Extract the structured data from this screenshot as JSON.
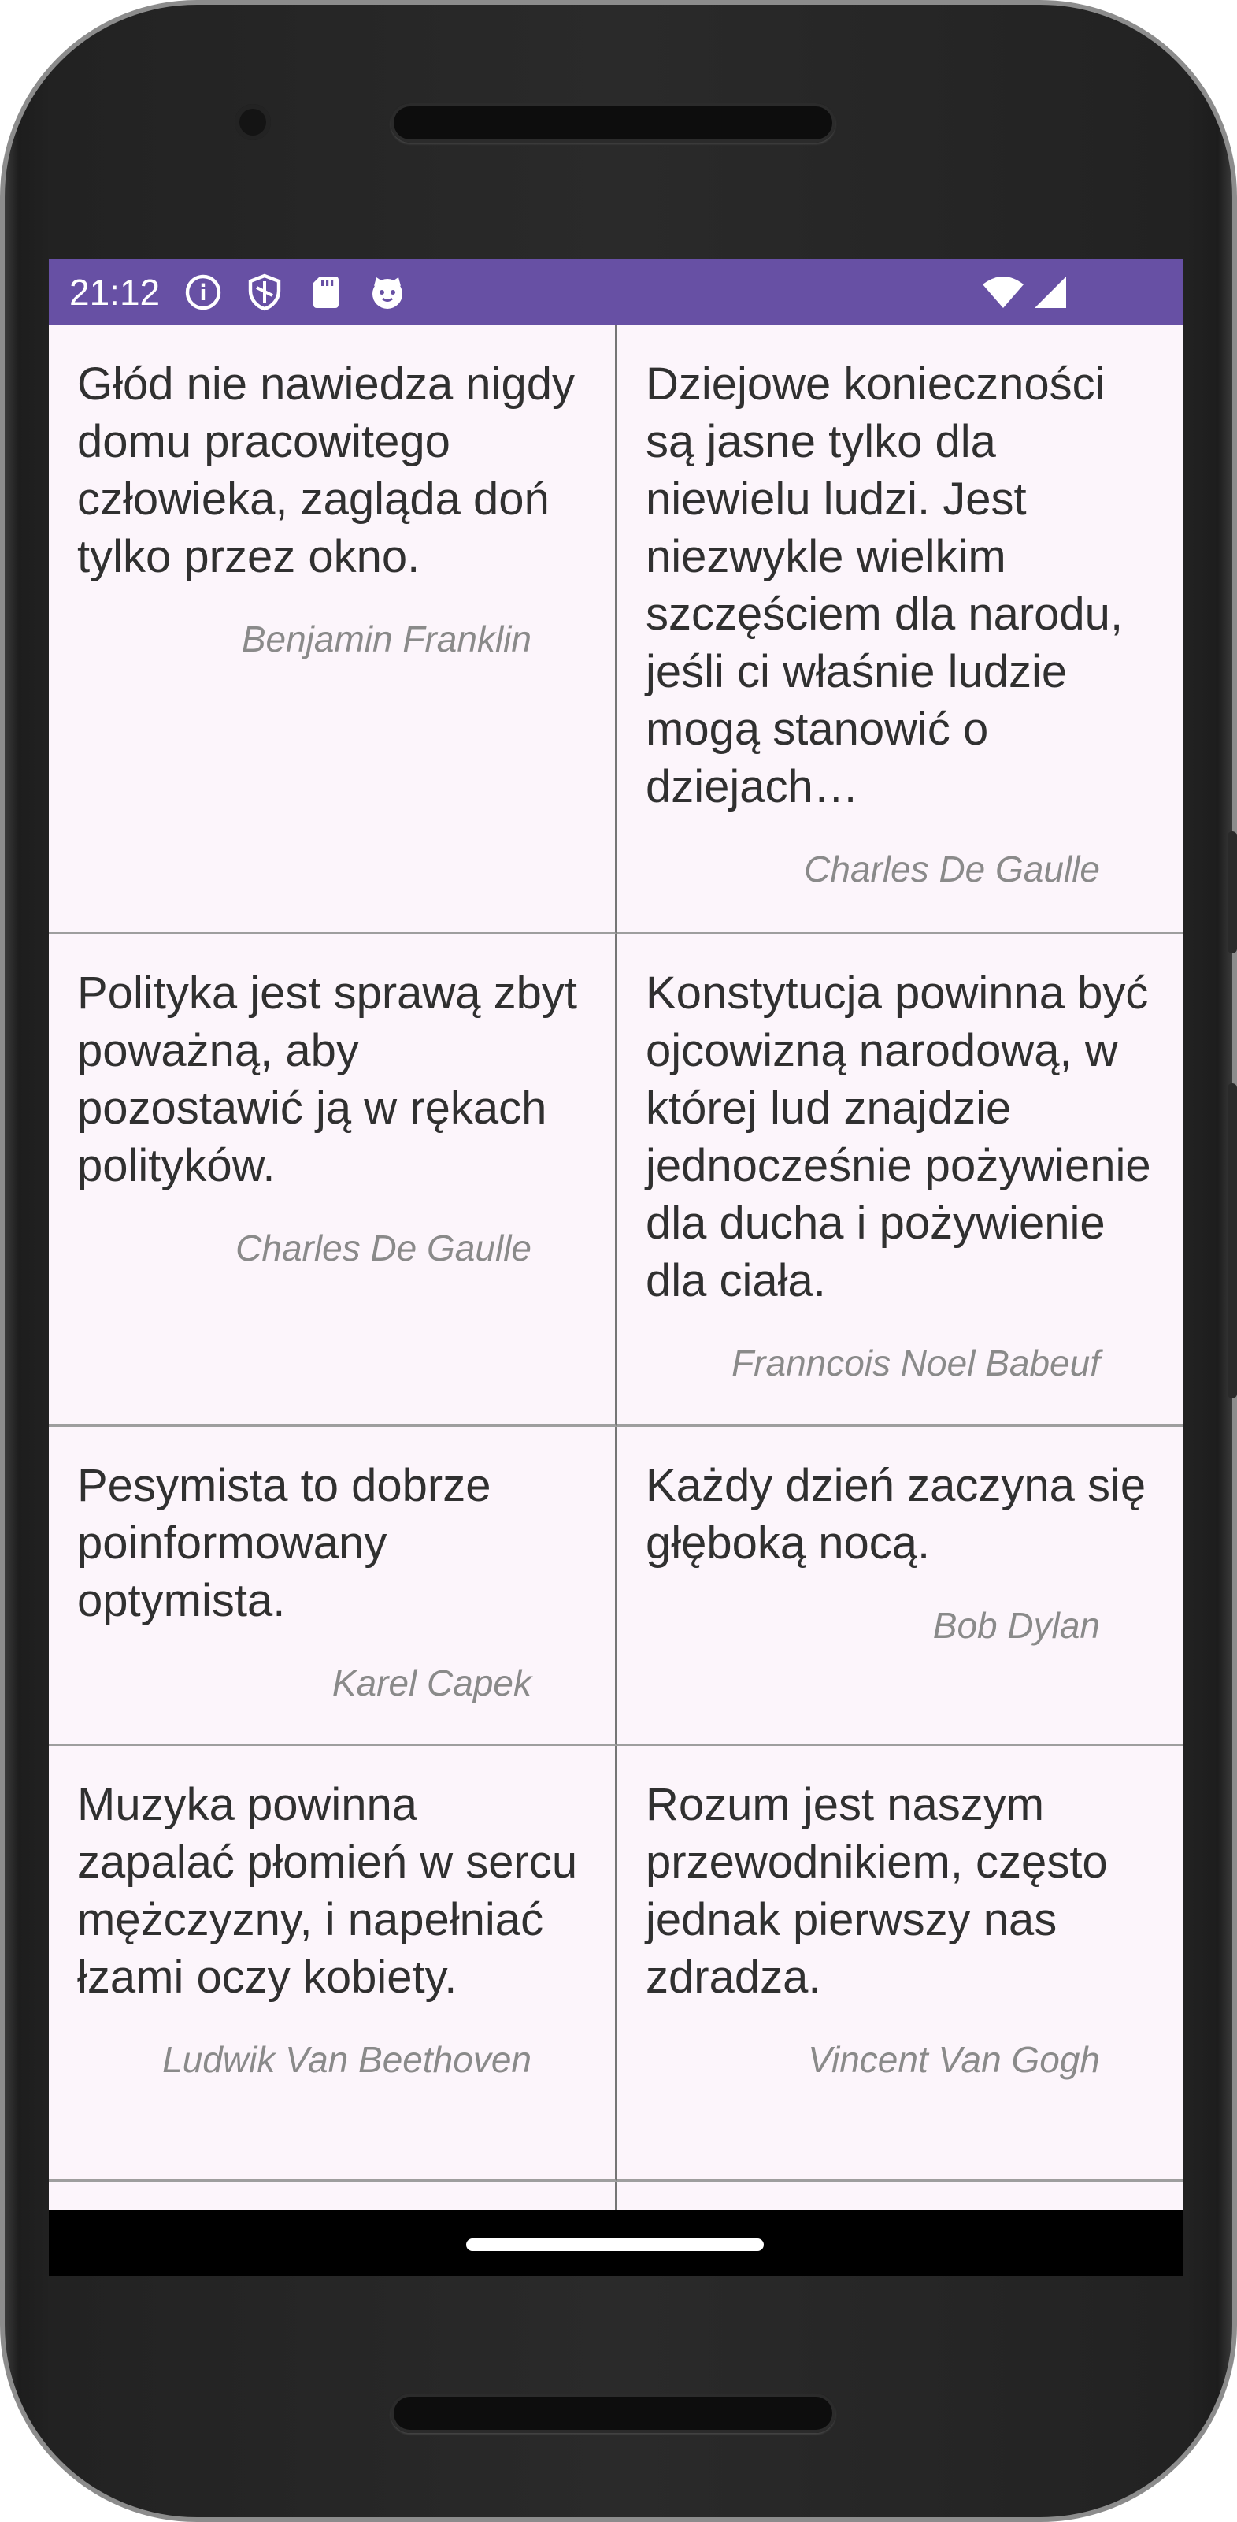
{
  "status_bar": {
    "time": "21:12",
    "icons_left": [
      "info-icon",
      "shield-icon",
      "sd-card-icon",
      "cat-face-icon"
    ],
    "icons_right": [
      "wifi-icon",
      "cellular-signal-icon"
    ],
    "color": "#6750a4"
  },
  "quotes": [
    {
      "text": "Głód nie nawiedza nigdy domu pracowitego człowieka, zagląda doń tylko przez okno.",
      "author": "Benjamin Franklin"
    },
    {
      "text": "Dziejowe konieczności są jasne tylko dla niewielu ludzi. Jest niezwykle wielkim szczęściem dla narodu, jeśli ci właśnie ludzie mogą stanowić o dziejach…",
      "author": "Charles De Gaulle"
    },
    {
      "text": "Polityka jest sprawą zbyt poważną, aby pozostawić ją w rękach polityków.",
      "author": "Charles De Gaulle"
    },
    {
      "text": "Konstytucja powinna być ojcowizną narodową, w której lud znajdzie jednocześnie pożywienie dla ducha i pożywienie dla ciała.",
      "author": "Franncois Noel Babeuf"
    },
    {
      "text": "Pesymista to dobrze poinformowany optymista.",
      "author": "Karel Capek"
    },
    {
      "text": "Każdy dzień zaczyna się głęboką nocą.",
      "author": "Bob Dylan"
    },
    {
      "text": "Muzyka powinna zapalać płomień w sercu mężczyzny, i napełniać łzami oczy kobiety.",
      "author": "Ludwik Van Beethoven"
    },
    {
      "text": "Rozum jest naszym przewodnikiem, często jednak pierwszy nas zdradza.",
      "author": "Vincent Van Gogh"
    }
  ],
  "colors": {
    "card_background": "#fcf5fb",
    "quote_text": "#303030",
    "author_text": "#8a8a8a",
    "nav_bar": "#000000"
  }
}
